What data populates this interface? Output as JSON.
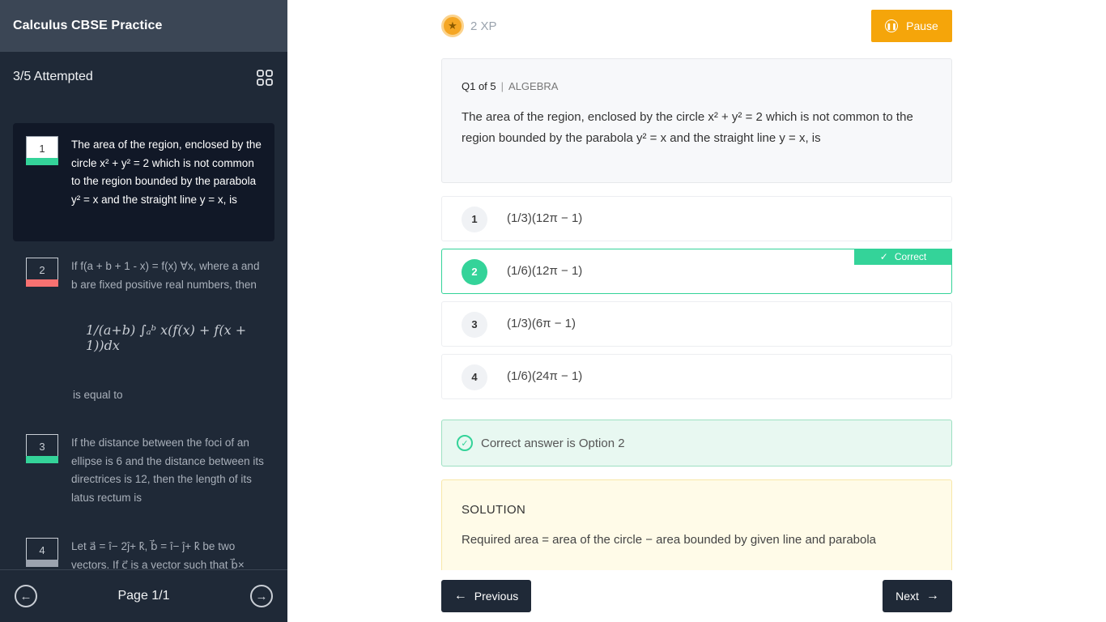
{
  "sidebar": {
    "title": "Calculus CBSE Practice",
    "attempted": "3/5 Attempted",
    "questions": [
      {
        "number": "1",
        "text": "The area of the region, enclosed by the circle x² + y² = 2 which is not common to the region bounded by the parabola y² = x and the straight line y = x, is",
        "status_color": "#34d399"
      },
      {
        "number": "2",
        "text": "If f(a + b + 1 - x) = f(x) ∀x, where a and b are fixed positive real numbers, then",
        "math": "1/(a+b) ∫ₐᵇ x(f(x) + f(x + 1))dx",
        "tail": "is equal to",
        "status_color": "#f87171"
      },
      {
        "number": "3",
        "text": "If the distance between the foci of an ellipse is 6 and the distance between its directrices is 12, then the length of its latus rectum is",
        "status_color": "#34d399"
      },
      {
        "number": "4",
        "text": "Let a⃗ = î− 2ĵ+ k̂, b⃗ = î− ĵ+ k̂ be two vectors. If c⃗ is a vector such that b⃗×",
        "status_color": "#9ca3af"
      }
    ],
    "page": "Page 1/1"
  },
  "header": {
    "xp": "2 XP",
    "pause_label": "Pause"
  },
  "question": {
    "label": "Q1 of 5",
    "category": "ALGEBRA",
    "text": "The area of the region, enclosed by the circle x² + y² = 2 which is not common to the region bounded by the parabola y² = x and the straight line y = x, is"
  },
  "options": [
    {
      "number": "1",
      "text": "(1/3)(12π − 1)"
    },
    {
      "number": "2",
      "text": "(1/6)(12π − 1)"
    },
    {
      "number": "3",
      "text": "(1/3)(6π − 1)"
    },
    {
      "number": "4",
      "text": "(1/6)(24π − 1)"
    }
  ],
  "correct_tag": "Correct",
  "answer_text": "Correct answer is Option 2",
  "solution": {
    "heading": "SOLUTION",
    "text": "Required area = area of the circle − area bounded by given line and parabola"
  },
  "nav": {
    "previous": "Previous",
    "next": "Next"
  },
  "colors": {
    "accent_green": "#34d399",
    "pause_orange": "#f5a50a",
    "sidebar_bg": "#1f2937"
  }
}
